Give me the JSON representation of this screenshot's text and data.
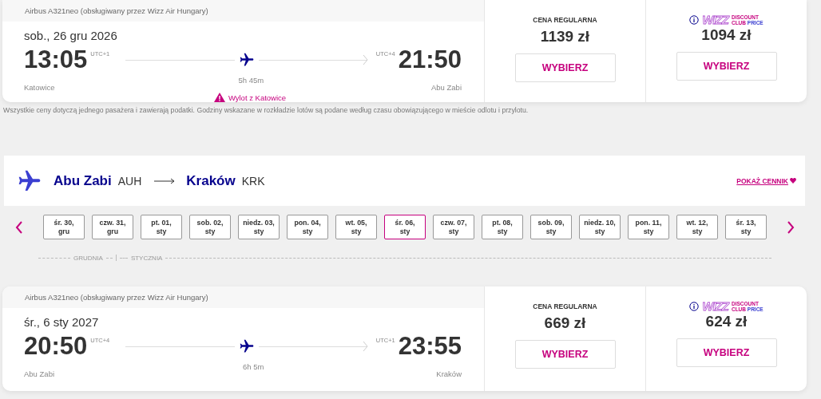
{
  "flights": [
    {
      "aircraft": "Airbus A321neo (obsługiwany przez Wizz Air Hungary)",
      "date": "sob., 26 gru 2026",
      "departure": {
        "time": "13:05",
        "utc": "UTC+1",
        "city": "Katowice"
      },
      "arrival": {
        "time": "21:50",
        "utc": "UTC+4",
        "city": "Abu Zabi"
      },
      "duration": "5h 45m",
      "warning": "Wylot z Katowice",
      "regular": {
        "label": "CENA REGULARNA",
        "price": "1139 zł",
        "button": "WYBIERZ"
      },
      "club": {
        "brand": "WIZZ",
        "line1": "DISCOUNT",
        "line2a": "CLUB",
        "line2b": "PRICE",
        "price": "1094 zł",
        "button": "WYBIERZ"
      }
    },
    {
      "aircraft": "Airbus A321neo (obsługiwany przez Wizz Air Hungary)",
      "date": "śr., 6 sty 2027",
      "departure": {
        "time": "20:50",
        "utc": "UTC+4",
        "city": "Abu Zabi"
      },
      "arrival": {
        "time": "23:55",
        "utc": "UTC+1",
        "city": "Kraków"
      },
      "duration": "6h 5m",
      "regular": {
        "label": "CENA REGULARNA",
        "price": "669 zł",
        "button": "WYBIERZ"
      },
      "club": {
        "brand": "WIZZ",
        "line1": "DISCOUNT",
        "line2a": "CLUB",
        "line2b": "PRICE",
        "price": "624 zł",
        "button": "WYBIERZ"
      }
    }
  ],
  "footnote": "Wszystkie ceny dotyczą jednego pasażera i zawierają podatki. Godziny wskazane w rozkładzie lotów są podane według czasu obowiązującego w mieście odlotu i przylotu.",
  "route": {
    "from_city": "Abu Zabi",
    "from_code": "AUH",
    "to_city": "Kraków",
    "to_code": "KRK",
    "link": "POKAŻ CENNIK"
  },
  "dates": [
    {
      "label": "śr. 30, gru",
      "selected": false
    },
    {
      "label": "czw. 31, gru",
      "selected": false
    },
    {
      "label": "pt. 01, sty",
      "selected": false
    },
    {
      "label": "sob. 02, sty",
      "selected": false
    },
    {
      "label": "niedz. 03, sty",
      "selected": false
    },
    {
      "label": "pon. 04, sty",
      "selected": false
    },
    {
      "label": "wt. 05, sty",
      "selected": false
    },
    {
      "label": "śr. 06, sty",
      "selected": true
    },
    {
      "label": "czw. 07, sty",
      "selected": false
    },
    {
      "label": "pt. 08, sty",
      "selected": false
    },
    {
      "label": "sob. 09, sty",
      "selected": false
    },
    {
      "label": "niedz. 10, sty",
      "selected": false
    },
    {
      "label": "pon. 11, sty",
      "selected": false
    },
    {
      "label": "wt. 12, sty",
      "selected": false
    },
    {
      "label": "śr. 13, sty",
      "selected": false
    }
  ],
  "months": [
    "GRUDNIA",
    "STYCZNIA"
  ]
}
